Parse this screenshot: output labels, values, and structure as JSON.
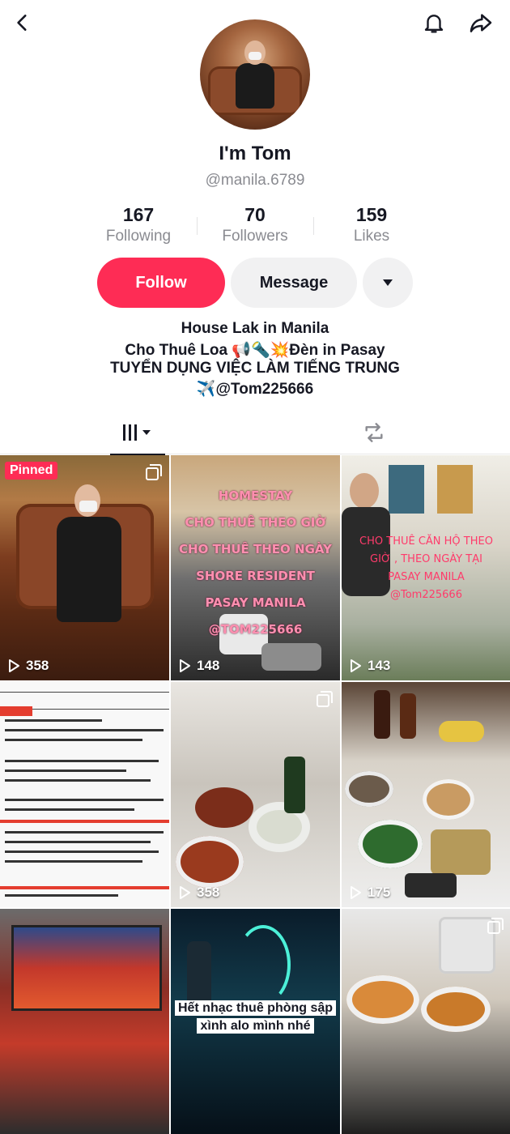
{
  "profile": {
    "name": "I'm Tom",
    "handle": "@manila.6789",
    "stats": {
      "following": {
        "value": "167",
        "label": "Following"
      },
      "followers": {
        "value": "70",
        "label": "Followers"
      },
      "likes": {
        "value": "159",
        "label": "Likes"
      }
    },
    "follow_label": "Follow",
    "message_label": "Message",
    "bio": [
      "House Lak in Manila",
      "Cho Thuê Loa 📢🔦💥Đèn in Pasay",
      "TUYỂN DỤNG VIỆC LÀM TIẾNG TRUNG",
      "✈️@Tom225666"
    ]
  },
  "icons": {
    "back": "chevron-left-icon",
    "bell": "bell-icon",
    "share": "share-icon",
    "dropdown": "caret-down-icon",
    "videos_tab": "grid-icon",
    "reposts_tab": "repost-icon",
    "play": "play-icon",
    "multi": "multi-photo-icon"
  },
  "colors": {
    "accent": "#fe2c55",
    "secondary_bg": "#f1f1f2",
    "muted_text": "#8a8b91"
  },
  "videos": [
    {
      "views": "358",
      "pinned_label": "Pinned"
    },
    {
      "views": "148",
      "overlay": [
        "HOMESTAY",
        "CHO THUÊ THEO GIỜ",
        "CHO THUÊ THEO NGÀY",
        "SHORE RESIDENT",
        "PASAY MANILA",
        "@TOM225666"
      ]
    },
    {
      "views": "143",
      "overlay": [
        "CHO THUÊ CĂN HỘ THEO",
        "GIỜ , THEO NGÀY TẠI",
        "PASAY MANILA",
        "@Tom225666"
      ]
    },
    {
      "views": ""
    },
    {
      "views": "358"
    },
    {
      "views": "175"
    },
    {
      "views": ""
    },
    {
      "views": "",
      "caption": [
        "Hết nhạc thuê phòng sập",
        "xình alo mình nhé"
      ]
    },
    {
      "views": ""
    }
  ]
}
